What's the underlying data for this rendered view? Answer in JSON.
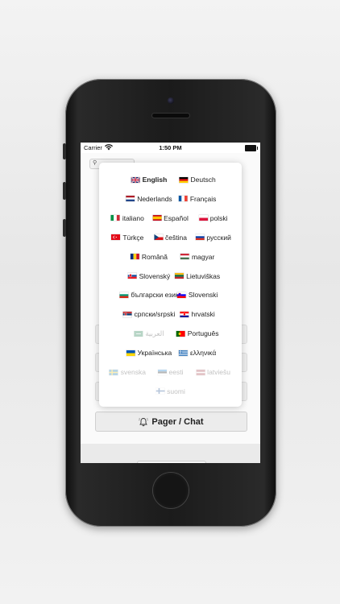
{
  "status_bar": {
    "carrier": "Carrier",
    "time": "1:50 PM"
  },
  "app": {
    "location_chip": "",
    "pager_button_label": "Pager / Chat"
  },
  "language_popover": {
    "rows": [
      [
        {
          "label": "English",
          "flag": "gb",
          "selected": true
        },
        {
          "label": "Deutsch",
          "flag": "de"
        }
      ],
      [
        {
          "label": "Nederlands",
          "flag": "nl"
        },
        {
          "label": "Français",
          "flag": "fr"
        }
      ],
      [
        {
          "label": "italiano",
          "flag": "it"
        },
        {
          "label": "Español",
          "flag": "es"
        },
        {
          "label": "polski",
          "flag": "pl"
        }
      ],
      [
        {
          "label": "Türkçe",
          "flag": "tr"
        },
        {
          "label": "čeština",
          "flag": "cz"
        },
        {
          "label": "русский",
          "flag": "ru"
        }
      ],
      [
        {
          "label": "Română",
          "flag": "ro"
        },
        {
          "label": "magyar",
          "flag": "hu"
        }
      ],
      [
        {
          "label": "Slovenský",
          "flag": "sk"
        },
        {
          "label": "Lietuviškas",
          "flag": "lt"
        }
      ],
      [
        {
          "label": "български език",
          "flag": "bg"
        },
        {
          "label": "Slovenski",
          "flag": "si"
        }
      ],
      [
        {
          "label": "српски/srpski",
          "flag": "rs"
        },
        {
          "label": "hrvatski",
          "flag": "hr"
        }
      ],
      [
        {
          "label": "العربية",
          "flag": "sa",
          "disabled": true
        },
        {
          "label": "Português",
          "flag": "pt"
        }
      ],
      [
        {
          "label": "Українська",
          "flag": "ua"
        },
        {
          "label": "ελληνικά",
          "flag": "gr"
        }
      ],
      [
        {
          "label": "svenska",
          "flag": "se",
          "disabled": true
        },
        {
          "label": "eesti",
          "flag": "ee",
          "disabled": true
        },
        {
          "label": "latviešu",
          "flag": "lv",
          "disabled": true
        }
      ],
      [
        {
          "label": "suomi",
          "flag": "fi",
          "disabled": true
        }
      ]
    ]
  },
  "colors": {
    "screen_bg": "#fafafa",
    "popover_bg": "#ffffff",
    "text": "#222222"
  }
}
